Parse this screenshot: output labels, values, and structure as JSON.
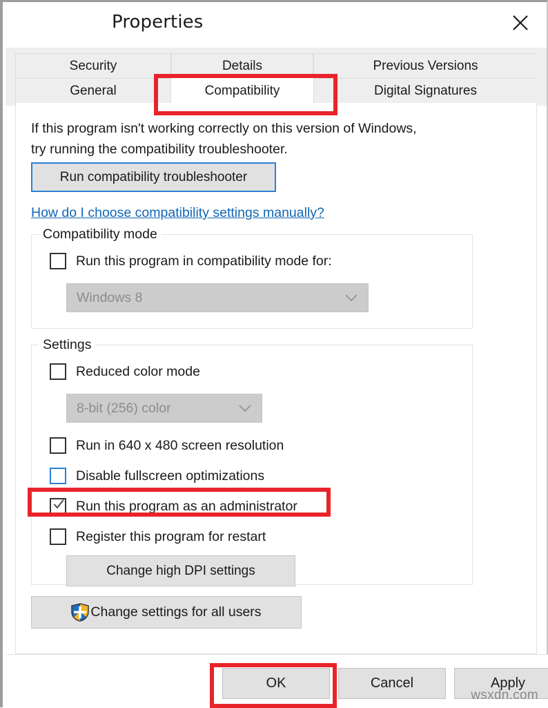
{
  "window": {
    "title": "Properties",
    "close_icon": "close-icon"
  },
  "tabs": {
    "row1": [
      {
        "label": "Security",
        "selected": false
      },
      {
        "label": "Details",
        "selected": false
      },
      {
        "label": "Previous Versions",
        "selected": false
      }
    ],
    "row2": [
      {
        "label": "General",
        "selected": false
      },
      {
        "label": "Compatibility",
        "selected": true
      },
      {
        "label": "Digital Signatures",
        "selected": false
      }
    ]
  },
  "content": {
    "intro_line1": "If this program isn't working correctly on this version of Windows,",
    "intro_line2": "try running the compatibility troubleshooter.",
    "troubleshoot_button": "Run compatibility troubleshooter",
    "help_link": "How do I choose compatibility settings manually?"
  },
  "compatibility_mode": {
    "legend": "Compatibility mode",
    "checkbox_label": "Run this program in compatibility mode for:",
    "checkbox_checked": false,
    "dropdown_value": "Windows 8",
    "dropdown_enabled": false
  },
  "settings": {
    "legend": "Settings",
    "reduced_color_label": "Reduced color mode",
    "reduced_color_checked": false,
    "color_depth_value": "8-bit (256) color",
    "color_depth_enabled": false,
    "resolution_label": "Run in 640 x 480 screen resolution",
    "resolution_checked": false,
    "fullscreen_label": "Disable fullscreen optimizations",
    "fullscreen_checked": false,
    "admin_label": "Run this program as an administrator",
    "admin_checked": true,
    "restart_label": "Register this program for restart",
    "restart_checked": false,
    "dpi_button": "Change high DPI settings"
  },
  "all_users_button": {
    "label": "Change settings for all users",
    "icon": "uac-shield-icon"
  },
  "footer": {
    "ok": "OK",
    "cancel": "Cancel",
    "apply": "Apply"
  },
  "annotations": {
    "highlight_color": "#e8242a",
    "highlighted": [
      "Compatibility",
      "Run this program as an administrator",
      "OK"
    ]
  },
  "watermark": "wsxdn.com"
}
